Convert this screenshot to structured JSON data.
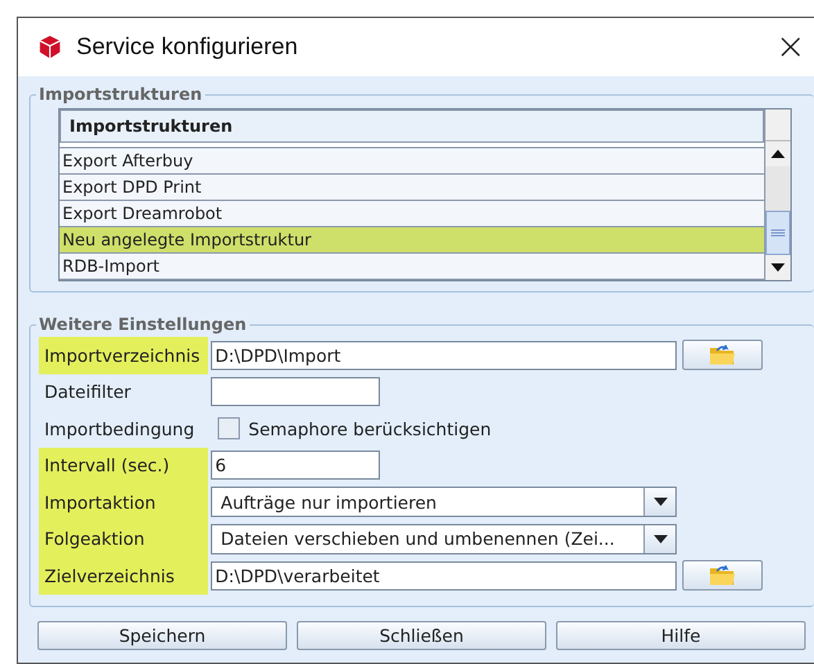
{
  "window": {
    "title": "Service konfigurieren",
    "close": "×"
  },
  "import_group": {
    "title": "Importstrukturen",
    "table": {
      "column": "Importstrukturen",
      "rows": [
        {
          "name": "Export Afterbuy",
          "selected": false
        },
        {
          "name": "Export DPD Print",
          "selected": false
        },
        {
          "name": "Export Dreamrobot",
          "selected": false
        },
        {
          "name": "Neu angelegte Importstruktur",
          "selected": true
        },
        {
          "name": "RDB-Import",
          "selected": false
        }
      ]
    }
  },
  "settings_group": {
    "title": "Weitere Einstellungen",
    "fields": [
      {
        "kind": "path",
        "label": "Importverzeichnis",
        "highlighted": true,
        "value": "D:\\DPD\\Import"
      },
      {
        "kind": "text",
        "label": "Dateifilter",
        "highlighted": false
      },
      {
        "kind": "checkbox",
        "label": "Importbedingung",
        "highlighted": false,
        "option": "Semaphore berücksichtigen",
        "checked": false
      },
      {
        "kind": "text",
        "label": "Intervall (sec.)",
        "highlighted": true,
        "value": "6"
      },
      {
        "kind": "combo",
        "label": "Importaktion",
        "highlighted": true,
        "value": "Aufträge nur importieren"
      },
      {
        "kind": "combo",
        "label": "Folgeaktion",
        "highlighted": true,
        "value": "Dateien verschieben und umbenennen (Zei..."
      },
      {
        "kind": "path",
        "label": "Zielverzeichnis",
        "highlighted": true,
        "value": "D:\\DPD\\verarbeitet"
      }
    ]
  },
  "buttons": [
    "Speichern",
    "Schließen",
    "Hilfe"
  ]
}
